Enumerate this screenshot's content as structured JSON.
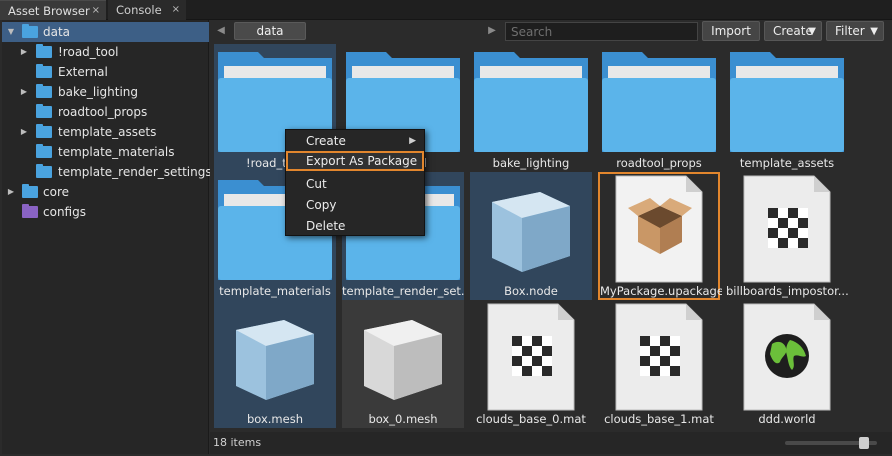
{
  "tabs": [
    {
      "label": "Asset Browser",
      "close": "×",
      "active": true
    },
    {
      "label": "Console",
      "close": "×",
      "active": false
    }
  ],
  "tree": [
    {
      "label": "data",
      "expanded": true,
      "selected": true,
      "icon": "folder-icon",
      "color": "#4aa3df"
    },
    {
      "label": "!road_tool",
      "expanded": false,
      "selected": false,
      "icon": "folder-icon",
      "color": "#4aa3df"
    },
    {
      "label": "External",
      "expanded": false,
      "selected": false,
      "icon": "folder-icon",
      "color": "#4aa3df"
    },
    {
      "label": "bake_lighting",
      "expanded": false,
      "selected": false,
      "icon": "folder-icon",
      "color": "#4aa3df"
    },
    {
      "label": "roadtool_props",
      "expanded": false,
      "selected": false,
      "icon": "folder-icon",
      "color": "#4aa3df"
    },
    {
      "label": "template_assets",
      "expanded": false,
      "selected": false,
      "icon": "folder-icon",
      "color": "#4aa3df"
    },
    {
      "label": "template_materials",
      "expanded": false,
      "selected": false,
      "icon": "folder-icon",
      "color": "#4aa3df"
    },
    {
      "label": "template_render_settings",
      "expanded": false,
      "selected": false,
      "icon": "folder-icon",
      "color": "#4aa3df"
    },
    {
      "label": "core",
      "expanded": false,
      "selected": false,
      "icon": "folder-icon",
      "color": "#4aa3df"
    },
    {
      "label": "configs",
      "expanded": false,
      "selected": false,
      "icon": "package-folder-icon",
      "color": "#8a63c4"
    }
  ],
  "toolbar": {
    "breadcrumb": "data",
    "search_placeholder": "Search",
    "import_label": "Import",
    "create_label": "Create",
    "filter_label": "Filter",
    "back_icon": "chevron-left-icon",
    "forward_icon": "chevron-right-icon"
  },
  "assets": [
    {
      "label": "!road_tool",
      "type": "folder"
    },
    {
      "label": "External",
      "type": "folder"
    },
    {
      "label": "bake_lighting",
      "type": "folder"
    },
    {
      "label": "roadtool_props",
      "type": "folder"
    },
    {
      "label": "template_assets",
      "type": "folder"
    },
    {
      "label": "template_materials",
      "type": "folder"
    },
    {
      "label": "template_render_set...",
      "type": "folder"
    },
    {
      "label": "Box.node",
      "type": "node"
    },
    {
      "label": "MyPackage.upackage",
      "type": "package"
    },
    {
      "label": "billboards_impostor...",
      "type": "material"
    },
    {
      "label": "box.mesh",
      "type": "mesh"
    },
    {
      "label": "box_0.mesh",
      "type": "mesh"
    },
    {
      "label": "clouds_base_0.mat",
      "type": "material"
    },
    {
      "label": "clouds_base_1.mat",
      "type": "material"
    },
    {
      "label": "ddd.world",
      "type": "world"
    }
  ],
  "context_menu": {
    "items": [
      {
        "label": "Create",
        "submenu": true
      },
      {
        "label": "Export As Package",
        "submenu": false
      },
      {
        "label": "Cut",
        "submenu": false
      },
      {
        "label": "Copy",
        "submenu": false
      },
      {
        "label": "Delete",
        "submenu": false
      }
    ]
  },
  "status": {
    "item_count": "18 items",
    "zoom_level": 0.9
  },
  "colors": {
    "accent": "#e2862d",
    "selection": "#3d5f86",
    "folder": "#4aa3df"
  }
}
